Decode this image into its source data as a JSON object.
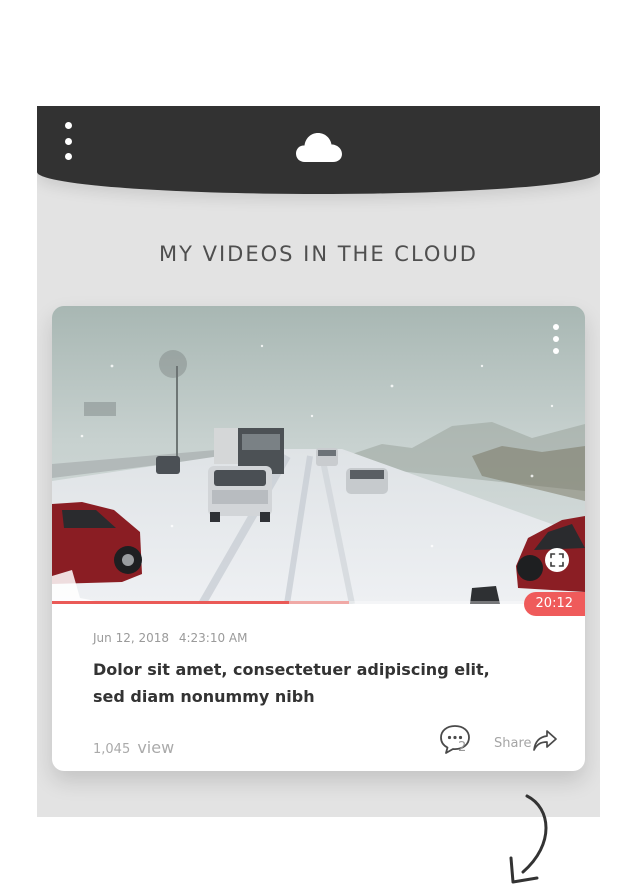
{
  "header": {
    "menu_icon": "vertical-dots-icon",
    "logo_icon": "cloud-icon"
  },
  "page": {
    "title": "MY VIDEOS IN THE CLOUD"
  },
  "video": {
    "duration": "20:12",
    "date": "Jun 12, 2018",
    "time": "4:23:10 AM",
    "description_line1": "Dolor sit amet, consectetuer adipiscing elit,",
    "description_line2": "sed diam nonummy nibh",
    "views_number": "1,045",
    "views_label": "view",
    "comment_count": "2",
    "share_label": "Share",
    "played_percent": 44.5,
    "buffered_percent": 55.7
  },
  "colors": {
    "header_bg": "#323232",
    "accent": "#ef5b5b",
    "frame_bg": "#e3e3e3"
  },
  "icons": {
    "video_menu": "vertical-dots-icon",
    "fullscreen": "fullscreen-icon",
    "comment": "comment-bubble-icon",
    "share": "share-arrow-icon",
    "scroll_hint": "curved-arrow-down-icon"
  }
}
